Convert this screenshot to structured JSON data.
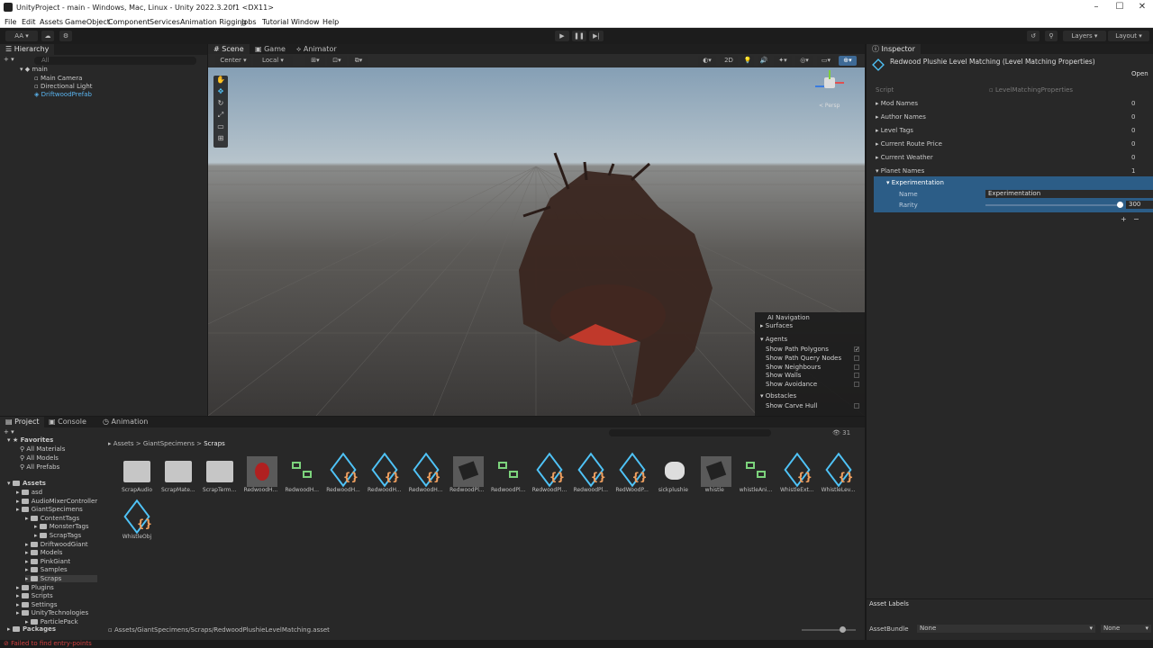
{
  "window": {
    "title": "UnityProject - main - Windows, Mac, Linux - Unity 2022.3.20f1 <DX11>"
  },
  "menu": [
    "File",
    "Edit",
    "Assets",
    "GameObject",
    "Component",
    "Services",
    "Animation Rigging",
    "Jobs",
    "Tutorial",
    "Window",
    "Help"
  ],
  "toolbar": {
    "account": "AA",
    "layers": "Layers",
    "layout": "Layout"
  },
  "hierarchy": {
    "tab": "Hierarchy",
    "search_placeholder": "All",
    "scene": "main",
    "items": [
      "Main Camera",
      "Directional Light",
      "DriftwoodPrefab"
    ]
  },
  "scene_tabs": [
    "Scene",
    "Game",
    "Animator"
  ],
  "scene_toolbar": {
    "pivot": "Center",
    "space": "Local",
    "mode2d": "2D"
  },
  "gizmo": {
    "label": "< Persp"
  },
  "ai_nav": {
    "title": "AI Navigation",
    "surfaces": "Surfaces",
    "agents": "Agents",
    "agent_opts": [
      "Show Path Polygons",
      "Show Path Query Nodes",
      "Show Neighbours",
      "Show Walls",
      "Show Avoidance"
    ],
    "obstacles": "Obstacles",
    "obstacle_opt": "Show Carve Hull"
  },
  "inspector": {
    "tab": "Inspector",
    "object_title": "Redwood Plushie Level Matching (Level Matching Properties)",
    "open_btn": "Open",
    "script_label": "Script",
    "script_value": "LevelMatchingProperties",
    "fields": [
      {
        "label": "Mod Names",
        "count": "0"
      },
      {
        "label": "Author Names",
        "count": "0"
      },
      {
        "label": "Level Tags",
        "count": "0"
      },
      {
        "label": "Current Route Price",
        "count": "0"
      },
      {
        "label": "Current Weather",
        "count": "0"
      },
      {
        "label": "Planet Names",
        "count": "1"
      }
    ],
    "element": {
      "title": "Experimentation",
      "name_label": "Name",
      "name_value": "Experimentation",
      "rarity_label": "Rarity",
      "rarity_value": "300"
    },
    "asset_labels": "Asset Labels",
    "assetbundle_label": "AssetBundle",
    "assetbundle_value": "None",
    "variant_value": "None"
  },
  "project": {
    "tabs": [
      "Project",
      "Console",
      "Animation"
    ],
    "favorites": {
      "label": "Favorites",
      "items": [
        "All Materials",
        "All Models",
        "All Prefabs"
      ]
    },
    "assets_root": "Assets",
    "tree": [
      {
        "label": "asd",
        "indent": 1
      },
      {
        "label": "AudioMixerController",
        "indent": 1
      },
      {
        "label": "GiantSpecimens",
        "indent": 1
      },
      {
        "label": "ContentTags",
        "indent": 2
      },
      {
        "label": "MonsterTags",
        "indent": 3
      },
      {
        "label": "ScrapTags",
        "indent": 3
      },
      {
        "label": "DriftwoodGiant",
        "indent": 2
      },
      {
        "label": "Models",
        "indent": 2
      },
      {
        "label": "PinkGiant",
        "indent": 2
      },
      {
        "label": "Samples",
        "indent": 2
      },
      {
        "label": "Scraps",
        "indent": 2
      },
      {
        "label": "Plugins",
        "indent": 1
      },
      {
        "label": "Scripts",
        "indent": 1
      },
      {
        "label": "Settings",
        "indent": 1
      },
      {
        "label": "UnityTechnologies",
        "indent": 1
      },
      {
        "label": "ParticlePack",
        "indent": 2
      }
    ],
    "packages": "Packages",
    "breadcrumb": [
      "Assets",
      "GiantSpecimens",
      "Scraps"
    ],
    "count": "31",
    "assets": [
      {
        "label": "ScrapAudio",
        "kind": "folder"
      },
      {
        "label": "ScrapMate...",
        "kind": "folder"
      },
      {
        "label": "ScrapTerm...",
        "kind": "folder"
      },
      {
        "label": "RedwoodH...",
        "kind": "red"
      },
      {
        "label": "RedwoodH...",
        "kind": "prefab"
      },
      {
        "label": "RedwoodH...",
        "kind": "script"
      },
      {
        "label": "RedwoodH...",
        "kind": "script"
      },
      {
        "label": "RedwoodH...",
        "kind": "script"
      },
      {
        "label": "RedwoodPl...",
        "kind": "model"
      },
      {
        "label": "RedwoodPl...",
        "kind": "prefab"
      },
      {
        "label": "RedwoodPl...",
        "kind": "script"
      },
      {
        "label": "RedwoodPl...",
        "kind": "script"
      },
      {
        "label": "RedWoodP...",
        "kind": "script"
      },
      {
        "label": "sickplushie",
        "kind": "model2"
      },
      {
        "label": "whistle",
        "kind": "model"
      },
      {
        "label": "whistleAni...",
        "kind": "prefab"
      },
      {
        "label": "WhistleExt...",
        "kind": "script"
      },
      {
        "label": "WhistleLev...",
        "kind": "script"
      },
      {
        "label": "WhistleObj",
        "kind": "script"
      }
    ],
    "path": "Assets/GiantSpecimens/Scraps/RedwoodPlushieLevelMatching.asset"
  },
  "status": {
    "message": "Failed to find entry-points"
  },
  "colors": {
    "accent": "#2c5d87",
    "selection": "#3e6a96",
    "scene_floor": "#4a4845",
    "red_disc": "#c0392b"
  }
}
